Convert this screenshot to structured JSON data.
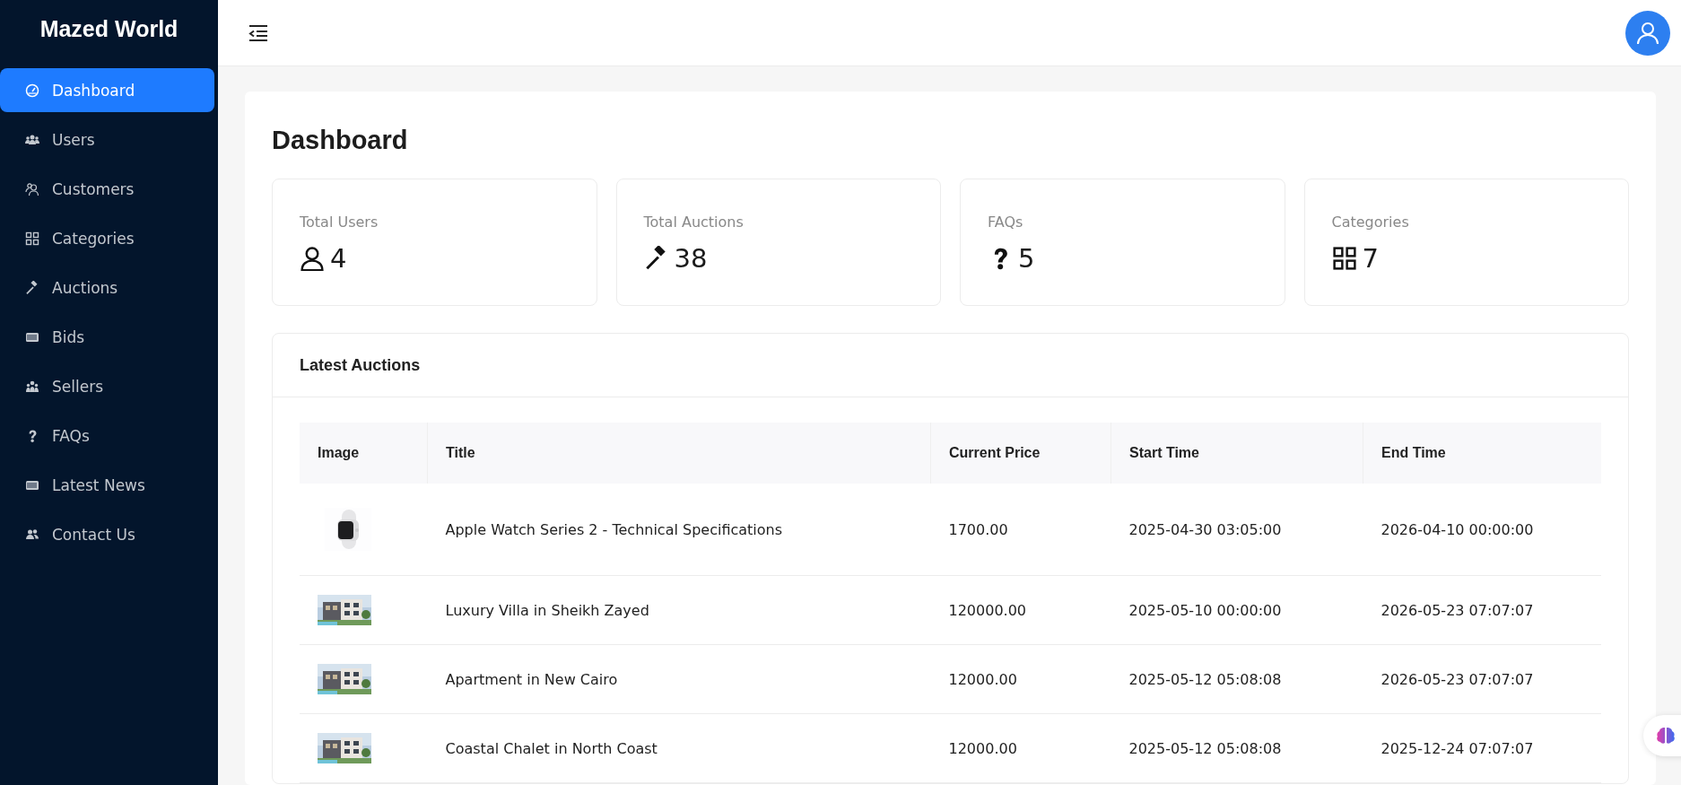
{
  "sidebar": {
    "brand": "Mazed World",
    "items": [
      {
        "label": "Dashboard",
        "selected": true
      },
      {
        "label": "Users",
        "selected": false
      },
      {
        "label": "Customers",
        "selected": false
      },
      {
        "label": "Categories",
        "selected": false
      },
      {
        "label": "Auctions",
        "selected": false
      },
      {
        "label": "Bids",
        "selected": false
      },
      {
        "label": "Sellers",
        "selected": false
      },
      {
        "label": "FAQs",
        "selected": false
      },
      {
        "label": "Latest News",
        "selected": false
      },
      {
        "label": "Contact Us",
        "selected": false
      }
    ]
  },
  "page_title": "Dashboard",
  "stats": [
    {
      "label": "Total Users",
      "value": "4"
    },
    {
      "label": "Total Auctions",
      "value": "38"
    },
    {
      "label": "FAQs",
      "value": "5"
    },
    {
      "label": "Categories",
      "value": "7"
    }
  ],
  "latest_auctions": {
    "title": "Latest Auctions",
    "columns": [
      "Image",
      "Title",
      "Current Price",
      "Start Time",
      "End Time"
    ],
    "rows": [
      {
        "title": "Apple Watch Series 2 - Technical Specifications",
        "price": "1700.00",
        "start": "2025-04-30 03:05:00",
        "end": "2026-04-10 00:00:00"
      },
      {
        "title": "Luxury Villa in Sheikh Zayed",
        "price": "120000.00",
        "start": "2025-05-10 00:00:00",
        "end": "2026-05-23 07:07:07"
      },
      {
        "title": "Apartment in New Cairo",
        "price": "12000.00",
        "start": "2025-05-12 05:08:08",
        "end": "2026-05-23 07:07:07"
      },
      {
        "title": "Coastal Chalet in North Coast",
        "price": "12000.00",
        "start": "2025-05-12 05:08:08",
        "end": "2025-12-24 07:07:07"
      }
    ]
  }
}
